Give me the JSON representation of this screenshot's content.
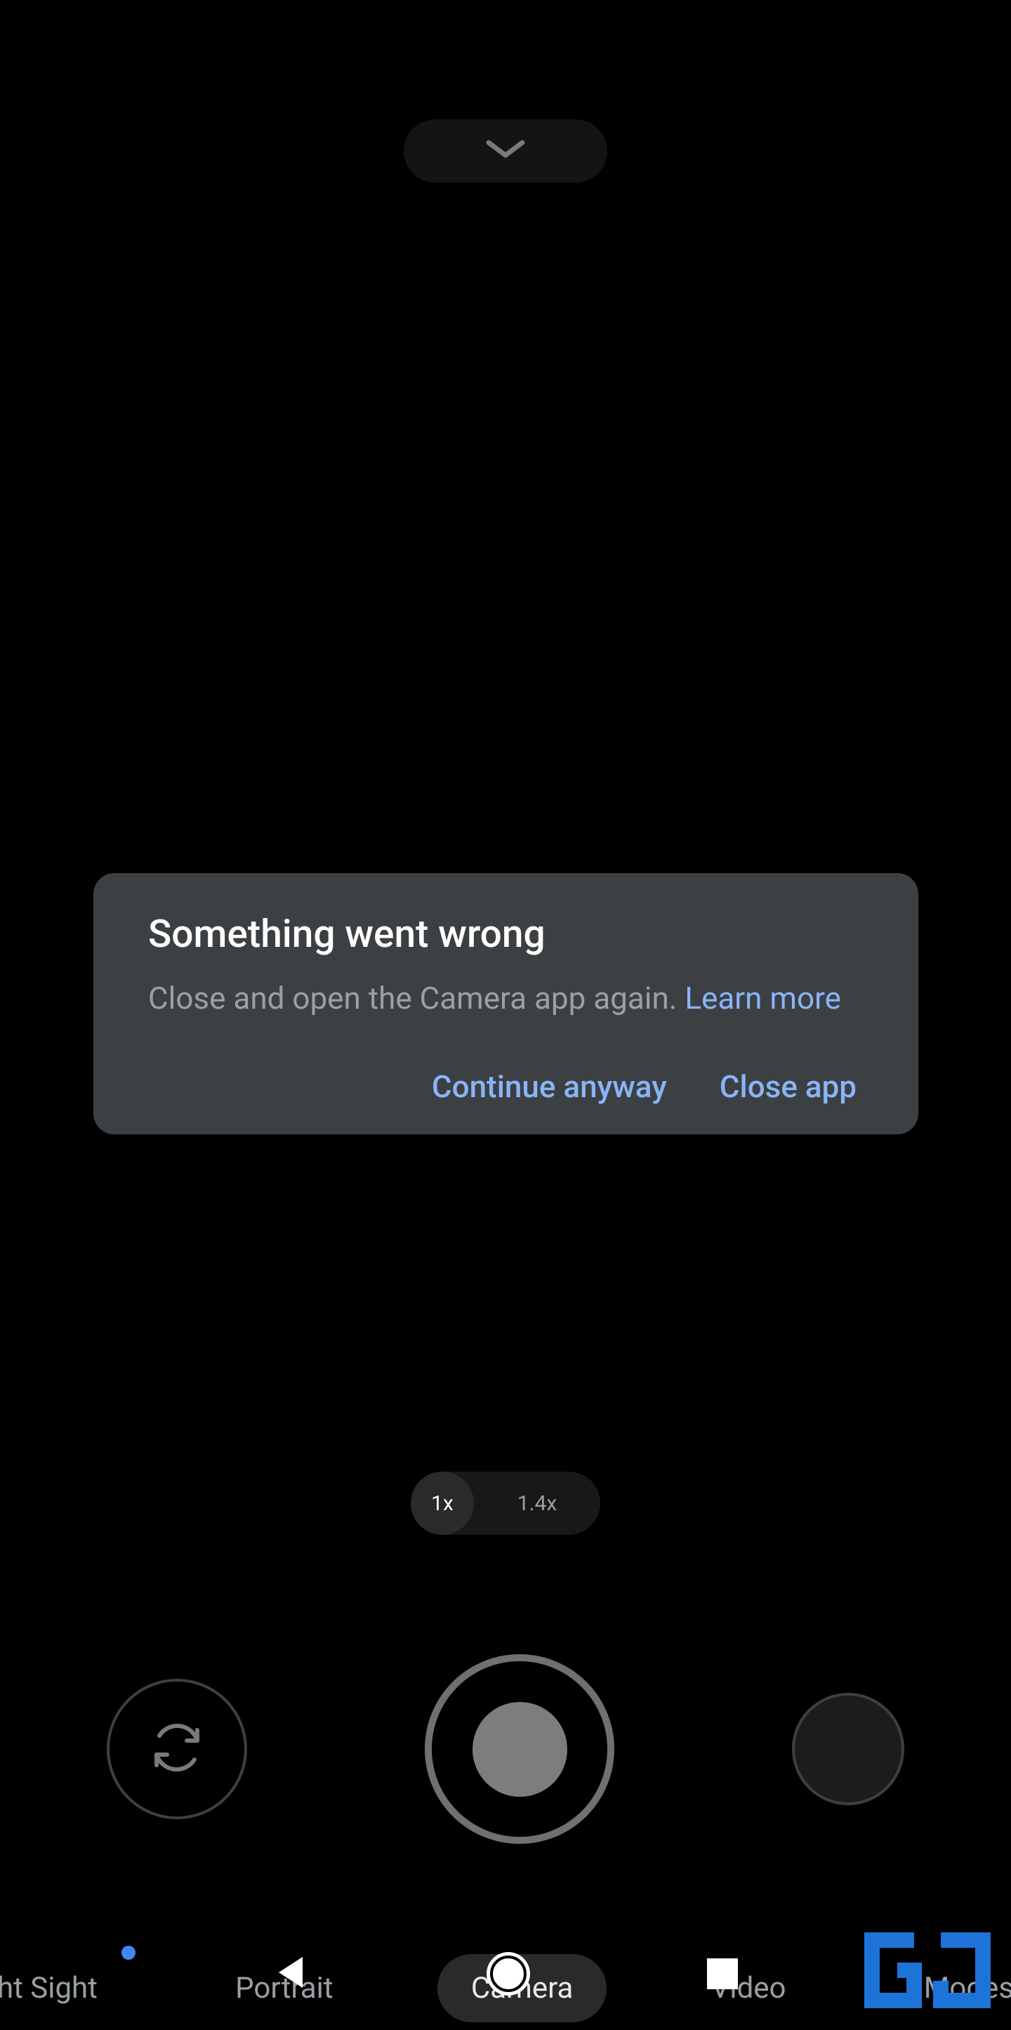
{
  "dialog": {
    "title": "Something went wrong",
    "body": "Close and open the Camera app again. ",
    "learn_more": "Learn more",
    "continue": "Continue anyway",
    "close": "Close app"
  },
  "zoom": {
    "option1": "1x",
    "option2": "1.4x"
  },
  "modes": {
    "night_sight": "ht Sight",
    "portrait": "Portrait",
    "camera": "Camera",
    "video": "Video",
    "modes": "Modes"
  },
  "colors": {
    "dialog_bg": "#3c4043",
    "link": "#8ab4f8",
    "muted": "#9aa0a4",
    "accent": "#4285f4"
  }
}
